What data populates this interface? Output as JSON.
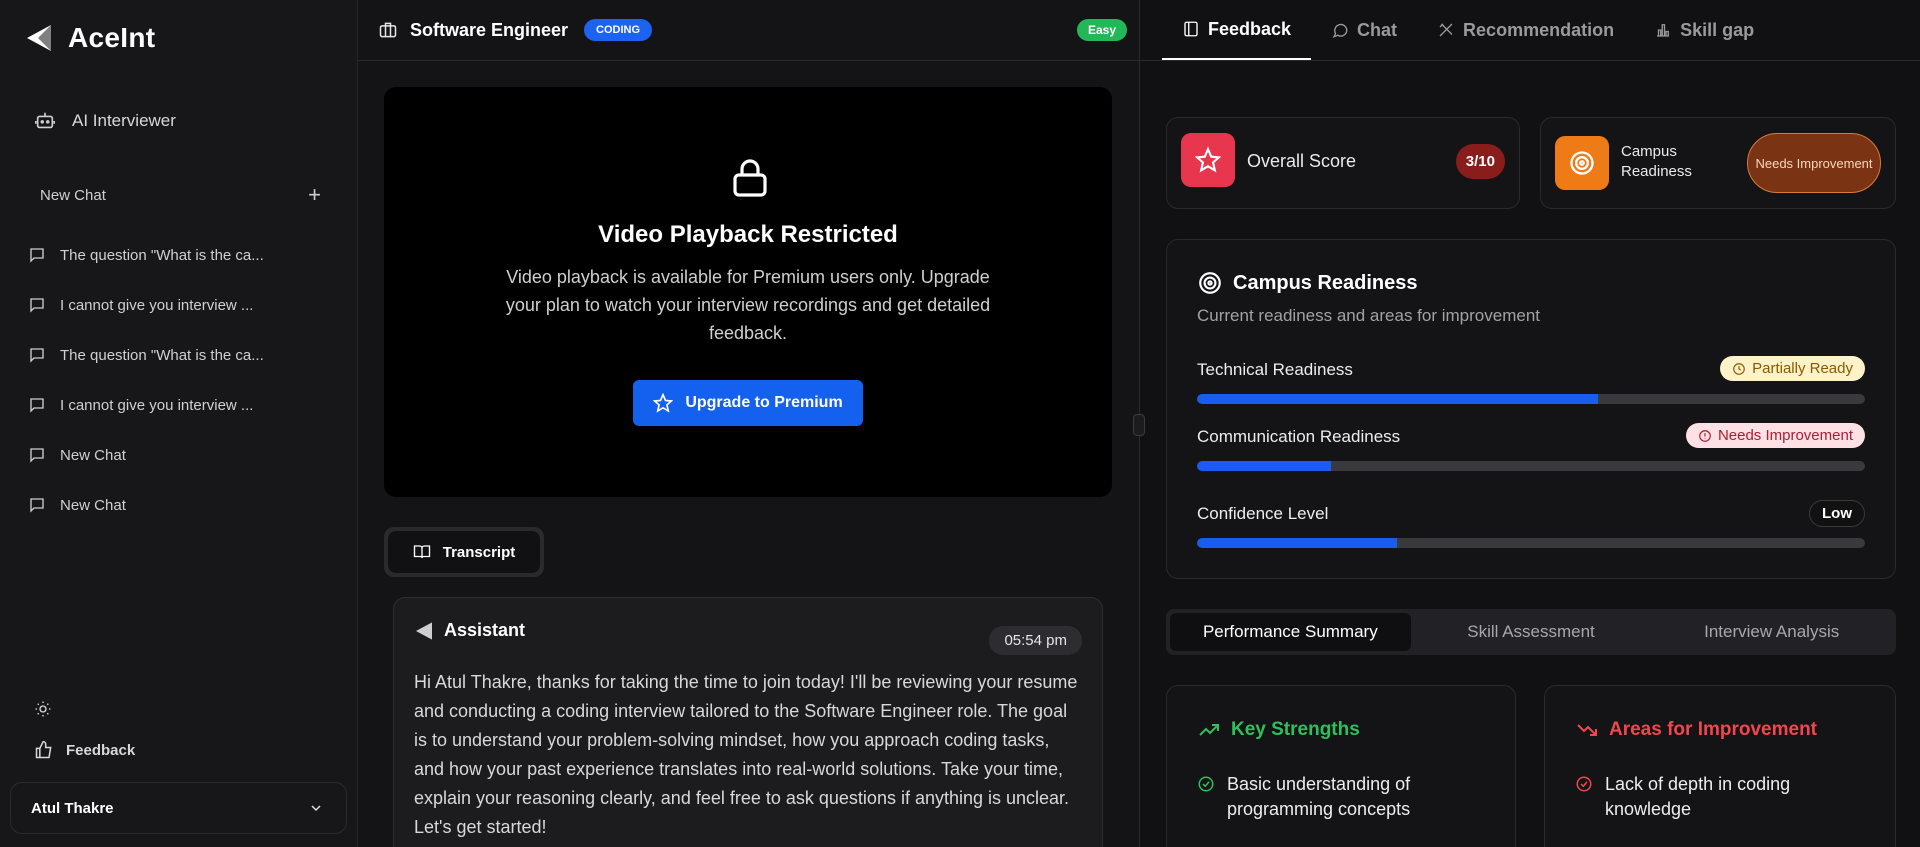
{
  "brand": {
    "name": "AceInt"
  },
  "sidebar": {
    "ai_interviewer": "AI Interviewer",
    "new_chat": "New Chat",
    "chats": [
      "The question \"What is the ca...",
      "I cannot give you interview ...",
      "The question \"What is the ca...",
      "I cannot give you interview ...",
      "New Chat",
      "New Chat"
    ],
    "feedback": "Feedback",
    "user_name": "Atul Thakre"
  },
  "interview": {
    "title": "Software Engineer",
    "type_badge": "CODING",
    "difficulty_badge": "Easy"
  },
  "video": {
    "heading": "Video Playback Restricted",
    "message": "Video playback is available for Premium users only. Upgrade your plan to watch your interview recordings and get detailed feedback.",
    "upgrade_label": "Upgrade to Premium"
  },
  "transcript": {
    "tab_label": "Transcript",
    "message": {
      "role": "Assistant",
      "time": "05:54 pm",
      "text": "Hi Atul Thakre, thanks for taking the time to join today! I'll be reviewing your resume and conducting a coding interview tailored to the Software Engineer role. The goal is to understand your problem-solving mindset, how you approach coding tasks, and how your past experience translates into real-world solutions. Take your time, explain your reasoning clearly, and feel free to ask questions if anything is unclear. Let's get started!"
    }
  },
  "right_tabs": [
    "Feedback",
    "Chat",
    "Recommendation",
    "Skill gap"
  ],
  "score": {
    "label": "Overall Score",
    "value": "3/10"
  },
  "readiness_summary": {
    "label": "Campus Readiness",
    "value": "Needs Improvement"
  },
  "campus": {
    "title": "Campus Readiness",
    "subtitle": "Current readiness and areas for improvement",
    "metrics": [
      {
        "label": "Technical Readiness",
        "status": "Partially Ready",
        "progress": 0.6
      },
      {
        "label": "Communication Readiness",
        "status": "Needs Improvement",
        "progress": 0.2
      },
      {
        "label": "Confidence Level",
        "status": "Low",
        "progress": 0.3
      }
    ]
  },
  "subtabs": [
    "Performance Summary",
    "Skill Assessment",
    "Interview Analysis"
  ],
  "strengths": {
    "title": "Key Strengths",
    "items": [
      "Basic understanding of programming concepts"
    ],
    "color": "#2fbf5c"
  },
  "improvements": {
    "title": "Areas for Improvement",
    "items": [
      "Lack of depth in coding knowledge"
    ],
    "color": "#f0474f"
  }
}
